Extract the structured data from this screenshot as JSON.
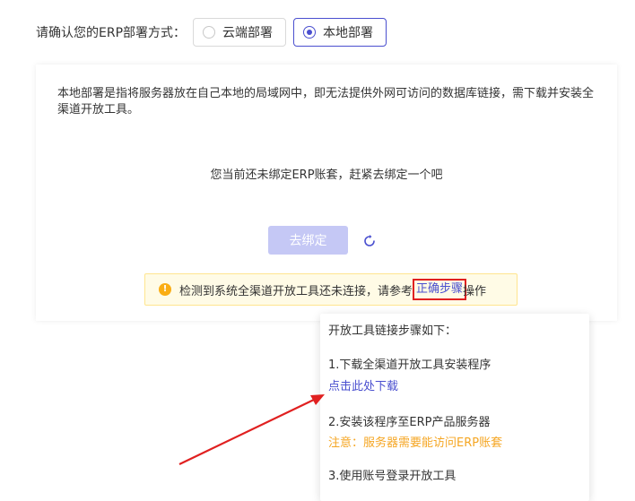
{
  "deploy": {
    "label": "请确认您的ERP部署方式：",
    "options": [
      {
        "label": "云端部署",
        "selected": false
      },
      {
        "label": "本地部署",
        "selected": true
      }
    ]
  },
  "card": {
    "description": "本地部署是指将服务器放在自己本地的局域网中，即无法提供外网可访问的数据库链接，需下载并安装全渠道开放工具。",
    "empty_message": "您当前还未绑定ERP账套，赶紧去绑定一个吧",
    "bind_button": "去绑定",
    "warning": {
      "text_before": "检测到系统全渠道开放工具还未连接，请参考",
      "link": "正确步骤",
      "text_after": "操作"
    }
  },
  "popover": {
    "title": "开放工具链接步骤如下：",
    "step1": "1.下载全渠道开放工具安装程序",
    "download_link": "点击此处下载",
    "step2": "2.安装该程序至ERP产品服务器",
    "note": "注意：服务器需要能访问ERP账套",
    "step3": "3.使用账号登录开放工具"
  },
  "colors": {
    "accent": "#4a4fcf",
    "warning": "#faad14",
    "note": "#f5a623",
    "annotation_red": "#e02020"
  }
}
